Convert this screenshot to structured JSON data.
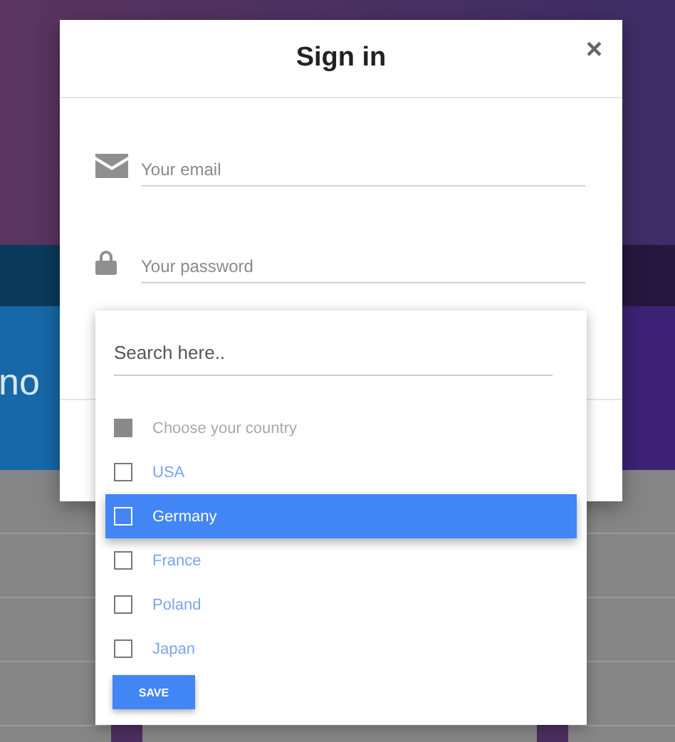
{
  "background": {
    "hero_text": "no"
  },
  "dialog": {
    "title": "Sign in",
    "close": "×",
    "fields": [
      {
        "kind": "email",
        "placeholder": "Your email"
      },
      {
        "kind": "password",
        "placeholder": "Your password"
      }
    ]
  },
  "dropdown": {
    "search": {
      "placeholder": "Search here.."
    },
    "options": [
      {
        "label": "Choose your country",
        "disabled": true,
        "checked": false,
        "selected": false
      },
      {
        "label": "USA",
        "disabled": false,
        "checked": false,
        "selected": false
      },
      {
        "label": "Germany",
        "disabled": false,
        "checked": false,
        "selected": true
      },
      {
        "label": "France",
        "disabled": false,
        "checked": false,
        "selected": false
      },
      {
        "label": "Poland",
        "disabled": false,
        "checked": false,
        "selected": false
      },
      {
        "label": "Japan",
        "disabled": false,
        "checked": false,
        "selected": false
      }
    ],
    "button": "SAVE"
  }
}
